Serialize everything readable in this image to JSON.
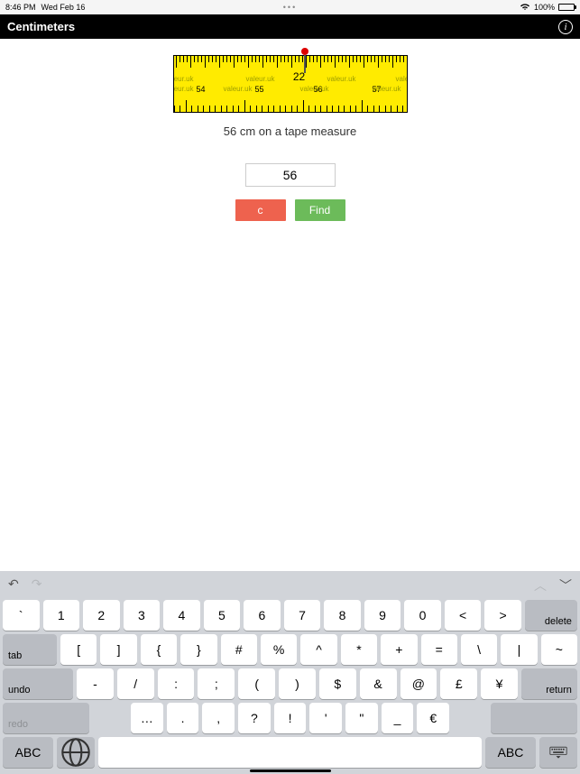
{
  "status": {
    "time": "8:46 PM",
    "date": "Wed Feb 16",
    "battery_pct": "100%"
  },
  "nav": {
    "title": "Centimeters"
  },
  "tape": {
    "watermark": "valeur.uk",
    "top_number": "22",
    "bottom_numbers": [
      "54",
      "55",
      "56",
      "57"
    ],
    "caption": "56 cm on a tape measure"
  },
  "input": {
    "value": "56"
  },
  "buttons": {
    "clear": "c",
    "find": "Find"
  },
  "keyboard": {
    "row1": [
      "`",
      "1",
      "2",
      "3",
      "4",
      "5",
      "6",
      "7",
      "8",
      "9",
      "0",
      "<",
      ">"
    ],
    "delete": "delete",
    "tab": "tab",
    "row2": [
      "[",
      "]",
      "{",
      "}",
      "#",
      "%",
      "^",
      "*",
      "+",
      "=",
      "\\",
      "|",
      "~"
    ],
    "undo": "undo",
    "row3": [
      "-",
      "/",
      ":",
      ";",
      "(",
      ")",
      "$",
      "&",
      "@",
      "£",
      "¥"
    ],
    "return": "return",
    "redo": "redo",
    "row4": [
      "…",
      ".",
      ",",
      "?",
      "!",
      "'",
      "\"",
      "_",
      "€"
    ],
    "abc": "ABC",
    "globe": "🌐"
  }
}
